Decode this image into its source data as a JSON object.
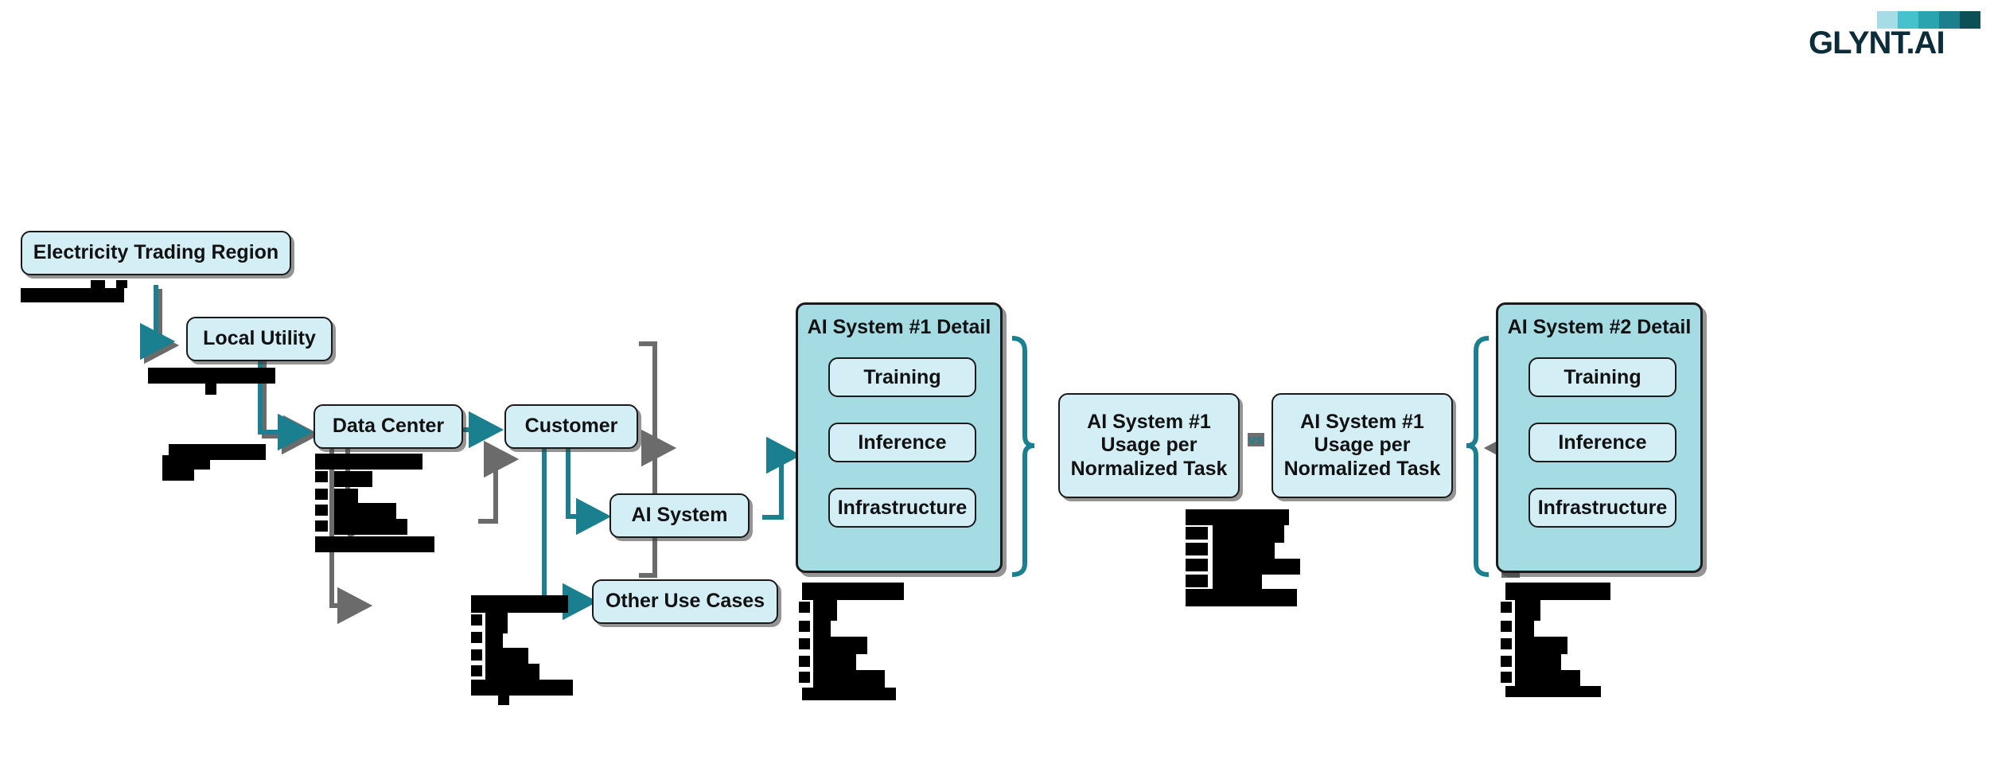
{
  "logo": {
    "name": "GLYNT.AI",
    "bar_colors": [
      "#a5dce5",
      "#45c3cc",
      "#2aa5b0",
      "#1c7f8e",
      "#0b4f57"
    ]
  },
  "colors": {
    "node_fill": "#d4eef5",
    "group_fill": "#a5dbe3",
    "connector": "#1a7f8e",
    "outline": "#1a1a1a",
    "shadow": "#3c3c3c",
    "redaction": "#000000"
  },
  "diagram": {
    "type": "flow",
    "nodes": [
      {
        "id": "electricity-trading-region",
        "label": "Electricity Trading Region"
      },
      {
        "id": "local-utility",
        "label": "Local Utility"
      },
      {
        "id": "data-center",
        "label": "Data Center"
      },
      {
        "id": "customer",
        "label": "Customer"
      },
      {
        "id": "ai-system",
        "label": "AI System"
      },
      {
        "id": "other-use-cases",
        "label": "Other Use Cases"
      },
      {
        "id": "ai-system-1-usage",
        "label": "AI System #1\nUsage per\nNormalized Task"
      },
      {
        "id": "ai-system-2-usage",
        "label": "AI System #1\nUsage per\nNormalized Task"
      }
    ],
    "groups": [
      {
        "id": "ai-system-1-detail",
        "title": "AI System #1 Detail",
        "items": [
          "Training",
          "Inference",
          "Infrastructure"
        ]
      },
      {
        "id": "ai-system-2-detail",
        "title": "AI System #2 Detail",
        "items": [
          "Training",
          "Inference",
          "Infrastructure"
        ]
      }
    ],
    "comparator": {
      "label": "vs"
    },
    "edges": [
      {
        "from": "electricity-trading-region",
        "to": "local-utility"
      },
      {
        "from": "local-utility",
        "to": "data-center"
      },
      {
        "from": "data-center",
        "to": "customer"
      },
      {
        "from": "customer",
        "to": "ai-system"
      },
      {
        "from": "customer",
        "to": "other-use-cases"
      },
      {
        "from": "ai-system",
        "to": "ai-system-1-detail"
      },
      {
        "from": "ai-system-1-detail",
        "to": "ai-system-1-usage"
      },
      {
        "from": "ai-system-2-usage",
        "to": "ai-system-2-detail"
      }
    ]
  },
  "usage_box_lines": {
    "line1": "AI System #1",
    "line2": "Usage per",
    "line3": "Normalized Task"
  },
  "group1": {
    "title": "AI System #1 Detail",
    "item1": "Training",
    "item2": "Inference",
    "item3": "Infrastructure"
  },
  "group2": {
    "title": "AI System #2 Detail",
    "item1": "Training",
    "item2": "Inference",
    "item3": "Infrastructure"
  },
  "labels": {
    "electricity_trading_region": "Electricity Trading Region",
    "local_utility": "Local Utility",
    "data_center": "Data Center",
    "customer": "Customer",
    "ai_system": "AI System",
    "other_use_cases": "Other Use Cases",
    "vs": "vs"
  }
}
